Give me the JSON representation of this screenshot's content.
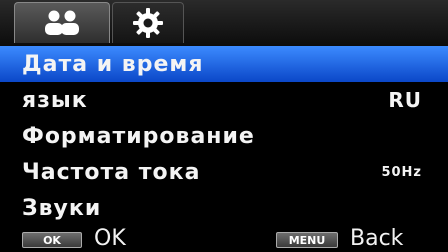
{
  "tabs": [
    {
      "icon": "people-icon",
      "active": true
    },
    {
      "icon": "gear-icon",
      "active": false
    }
  ],
  "menu": {
    "items": [
      {
        "label": "Дата и время",
        "value": "",
        "selected": true
      },
      {
        "label": "язык",
        "value": "RU",
        "selected": false
      },
      {
        "label": "Форматирование",
        "value": "",
        "selected": false
      },
      {
        "label": "Частота тока",
        "value": "50Hz",
        "selected": false
      },
      {
        "label": "Звуки",
        "value": "",
        "selected": false
      }
    ]
  },
  "footer": {
    "ok_key": "OK",
    "ok_label": "OK",
    "menu_key": "MENU",
    "back_label": "Back"
  },
  "colors": {
    "selected_bg": "#1a5fe0",
    "background": "#000000",
    "text": "#f2f2f2"
  }
}
